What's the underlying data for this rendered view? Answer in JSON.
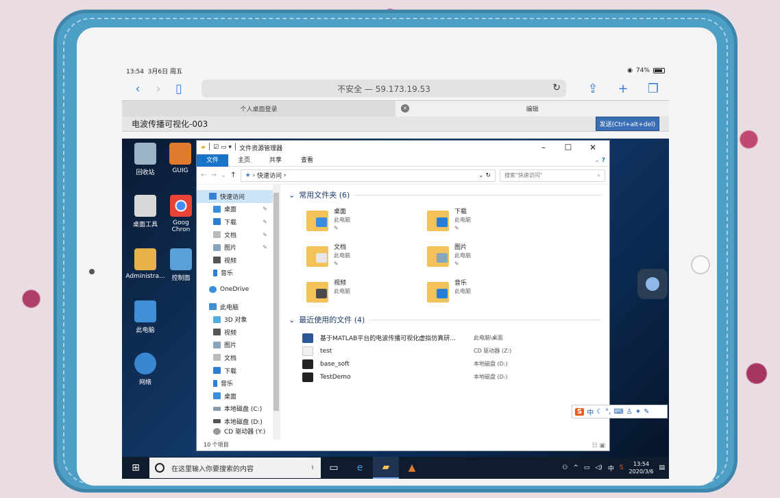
{
  "status": {
    "time": "13:54",
    "date": "3月6日 周五",
    "battery": "74%"
  },
  "browser": {
    "url": "不安全 — 59.173.19.53",
    "tabs": [
      {
        "label": "个人桌面登录"
      },
      {
        "label": "编辑"
      }
    ]
  },
  "rdp": {
    "title": "电波传播可视化-003",
    "send_button": "发送(Ctrl+alt+del)"
  },
  "desktop": {
    "icons": [
      {
        "label": "回收站"
      },
      {
        "label": "GUIG"
      },
      {
        "label": "桌面工具"
      },
      {
        "label": "Goog Chron"
      },
      {
        "label": "Administra..."
      },
      {
        "label": "控制面"
      },
      {
        "label": "此电脑"
      },
      {
        "label": "网络"
      }
    ]
  },
  "explorer": {
    "title": "文件资源管理器",
    "ribbon": [
      "文件",
      "主页",
      "共享",
      "查看"
    ],
    "address": "快速访问",
    "search_placeholder": "搜索\"快速访问\"",
    "nav": [
      {
        "label": "快速访问"
      },
      {
        "label": "桌面"
      },
      {
        "label": "下载"
      },
      {
        "label": "文档"
      },
      {
        "label": "图片"
      },
      {
        "label": "视频"
      },
      {
        "label": "音乐"
      },
      {
        "label": "OneDrive"
      },
      {
        "label": "此电脑"
      },
      {
        "label": "3D 对象"
      },
      {
        "label": "视频"
      },
      {
        "label": "图片"
      },
      {
        "label": "文档"
      },
      {
        "label": "下载"
      },
      {
        "label": "音乐"
      },
      {
        "label": "桌面"
      },
      {
        "label": "本地磁盘 (C:)"
      },
      {
        "label": "本地磁盘 (D:)"
      },
      {
        "label": "CD 驱动器 (Y:)"
      }
    ],
    "frequent_header": "常用文件夹 (6)",
    "folders": [
      {
        "name": "桌面",
        "loc": "此电脑"
      },
      {
        "name": "下载",
        "loc": "此电脑"
      },
      {
        "name": "文档",
        "loc": "此电脑"
      },
      {
        "name": "图片",
        "loc": "此电脑"
      },
      {
        "name": "视频",
        "loc": "此电脑"
      },
      {
        "name": "音乐",
        "loc": "此电脑"
      }
    ],
    "recent_header": "最近使用的文件 (4)",
    "recent": [
      {
        "name": "基于MATLAB平台的电波传播可视化虚拟仿真研...",
        "loc": "此电脑\\桌面"
      },
      {
        "name": "test",
        "loc": "CD 驱动器 (Z:)"
      },
      {
        "name": "base_soft",
        "loc": "本地磁盘 (D:)"
      },
      {
        "name": "TestDemo",
        "loc": "本地磁盘 (D:)"
      }
    ],
    "status": "10 个项目"
  },
  "ime": {
    "label": "中"
  },
  "taskbar": {
    "search_placeholder": "在这里输入你要搜索的内容",
    "time": "13:54",
    "date": "2020/3/6",
    "ime": "中"
  }
}
